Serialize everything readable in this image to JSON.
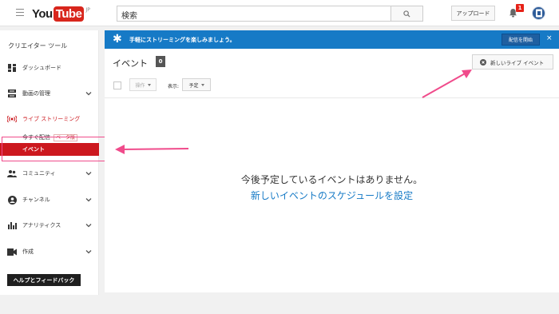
{
  "header": {
    "logo_you": "You",
    "logo_tube": "Tube",
    "logo_region": "JP",
    "search_placeholder": "検索",
    "upload_label": "アップロード",
    "notification_count": "1"
  },
  "sidebar": {
    "title": "クリエイター ツール",
    "items": [
      {
        "label": "ダッシュボード",
        "icon": "dashboard-icon"
      },
      {
        "label": "動画の管理",
        "icon": "video-manager-icon"
      },
      {
        "label": "ライブ ストリーミング",
        "icon": "live-streaming-icon"
      },
      {
        "label": "コミュニティ",
        "icon": "community-icon"
      },
      {
        "label": "チャンネル",
        "icon": "channel-icon"
      },
      {
        "label": "アナリティクス",
        "icon": "analytics-icon"
      },
      {
        "label": "作成",
        "icon": "create-icon"
      }
    ],
    "sub_live_now": "今すぐ配信",
    "sub_beta": "ベータ版",
    "sub_events": "イベント",
    "help_label": "ヘルプとフィードバック"
  },
  "banner": {
    "text": "手軽にストリーミングを楽しみましょう。",
    "button": "配信を開始",
    "close": "×"
  },
  "main": {
    "title": "イベント",
    "count": "0",
    "new_live_label": "新しいライブ イベント",
    "ops_label": "操作",
    "show_label": "表示:",
    "filter_value": "予定",
    "empty_message": "今後予定しているイベントはありません。",
    "empty_link": "新しいイベントのスケジュールを設定"
  },
  "colors": {
    "accent_blue": "#167ac6",
    "active_red": "#cc181e",
    "annotation_pink": "#f04b8b"
  }
}
